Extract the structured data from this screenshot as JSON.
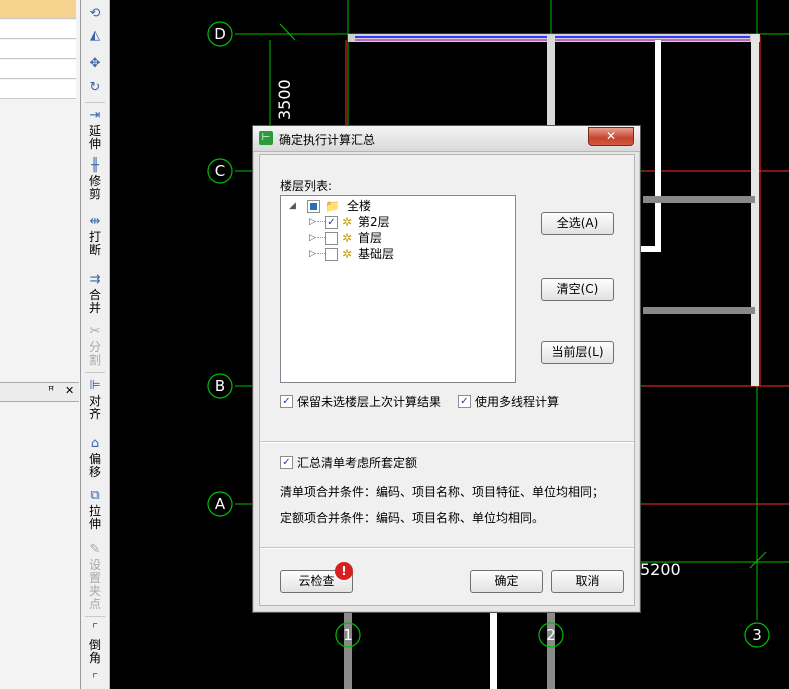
{
  "toolbar": {
    "extend_label": "延伸",
    "trim_label": "修剪",
    "break_label": "打断",
    "merge_label": "合并",
    "split_label": "分割",
    "align_label": "对齐",
    "offset_label": "偏移",
    "stretch_label": "拉伸",
    "grip_label": "设置夹点",
    "chamfer_label": "倒角"
  },
  "left_panel": {
    "pin_icon": "pin-icon",
    "close_glyph": "✕",
    "pin_glyph": "ꟸ"
  },
  "canvas": {
    "axis_d": "D",
    "axis_c": "C",
    "axis_b": "B",
    "axis_a": "A",
    "axis_1": "1",
    "axis_2": "2",
    "axis_3": "3",
    "dim_vertical": "3500",
    "dim_horizontal": "5200"
  },
  "dialog": {
    "title": "确定执行计算汇总",
    "close_glyph": "✕",
    "floor_list_label": "楼层列表:",
    "tree": {
      "root": "全楼",
      "floors": [
        {
          "name": "第2层",
          "checked": true
        },
        {
          "name": "首层",
          "checked": false
        },
        {
          "name": "基础层",
          "checked": false
        }
      ]
    },
    "select_all_label": "全选(A)",
    "clear_label": "清空(C)",
    "current_floor_label": "当前层(L)",
    "keep_results_label": "保留未选楼层上次计算结果",
    "multithread_label": "使用多线程计算",
    "summary_quota_label": "汇总清单考虑所套定额",
    "bill_merge_condition": "清单项合并条件：编码、项目名称、项目特征、单位均相同；",
    "quota_merge_condition": "定额项合并条件：编码、项目名称、单位均相同。",
    "cloud_check_label": "云检查",
    "ok_label": "确定",
    "cancel_label": "取消",
    "warn_glyph": "!",
    "check_glyph": "✓"
  },
  "colors": {
    "grid_green": "#00c000",
    "axis_red": "#ff2a2a",
    "wall_gray": "#8a8a8a",
    "dialog_bg": "#f0f0f0",
    "close_red": "#c6442d"
  }
}
